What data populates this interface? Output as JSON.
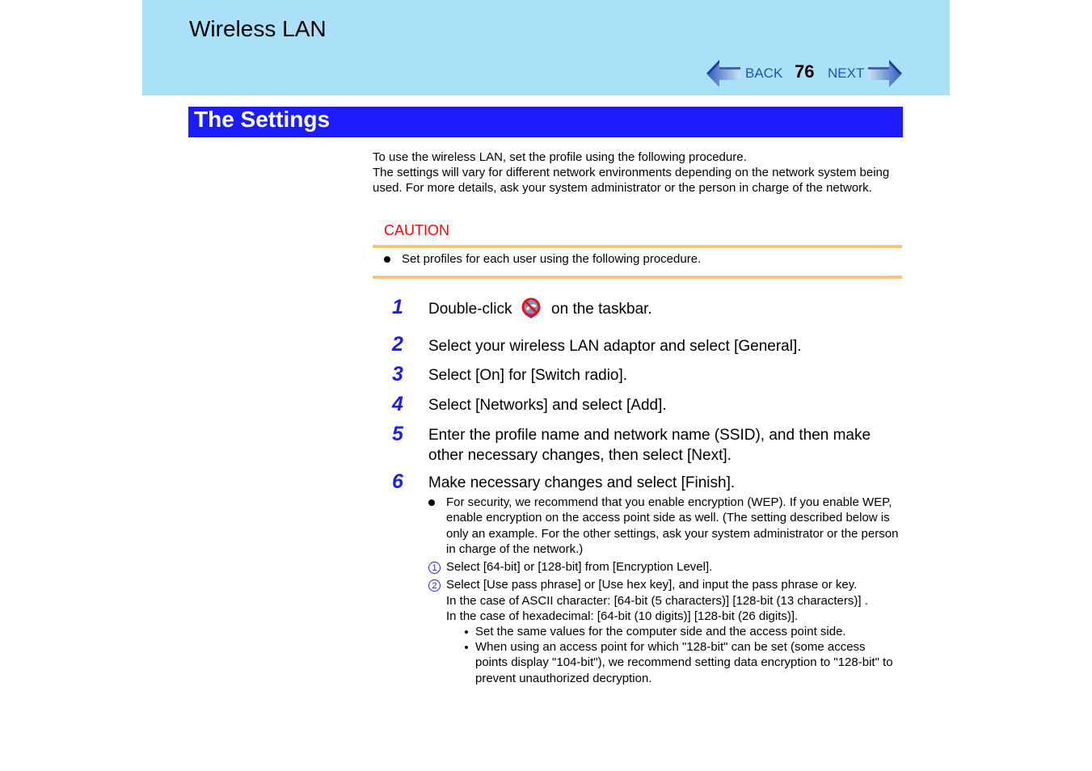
{
  "header": {
    "title": "Wireless LAN",
    "nav": {
      "back_label": "BACK",
      "next_label": "NEXT",
      "page_number": "76",
      "back_icon": "left-arrow-icon",
      "next_icon": "right-arrow-icon"
    }
  },
  "section": {
    "title": "The Settings"
  },
  "intro": {
    "line1": "To use the wireless LAN, set the profile using the following procedure.",
    "line2": "The settings will vary for different network environments depending on the network system being used. For more details, ask your system administrator or the person in charge of the network."
  },
  "caution": {
    "title": "CAUTION",
    "items": [
      "Set profiles for each user using the following procedure."
    ]
  },
  "steps": [
    {
      "num": "1",
      "text_before": "Double-click",
      "icon": "wireless-tray-icon",
      "text_after": "on the taskbar."
    },
    {
      "num": "2",
      "text": "Select your wireless LAN adaptor and select [General]."
    },
    {
      "num": "3",
      "text": "Select [On] for [Switch radio]."
    },
    {
      "num": "4",
      "text": "Select [Networks] and select [Add]."
    },
    {
      "num": "5",
      "text": "Enter the profile name and network name (SSID), and then make other necessary changes, then select [Next]."
    },
    {
      "num": "6",
      "text": "Make necessary changes and select [Finish]."
    }
  ],
  "step6_details": {
    "bullet": "For security, we recommend that you enable encryption (WEP). If you enable WEP, enable encryption on the access point side as well. (The setting described below is only an example. For the other settings, ask your system administrator or the person in charge of the network.)",
    "substeps": [
      {
        "marker": "1",
        "lines": [
          "Select [64-bit] or [128-bit] from [Encryption Level]."
        ]
      },
      {
        "marker": "2",
        "lines": [
          "Select [Use pass phrase] or [Use hex key], and input the pass phrase or key.",
          "In the case of ASCII character: [64-bit (5 characters)] [128-bit (13 characters)] .",
          "In the case of hexadecimal: [64-bit (10 digits)] [128-bit (26 digits)]."
        ]
      }
    ],
    "notes": [
      "Set the same values for the computer side and the access point side.",
      "When using an access point for which \"128-bit\" can be set (some access points display \"104-bit\"), we recommend setting data encryption to \"128-bit\" to prevent unauthorized decryption."
    ]
  },
  "colors": {
    "header_bg": "#aae1f8",
    "section_bar": "#1c1cff",
    "caution_red": "#ff0000",
    "caution_rule": "#f9c47a",
    "step_number": "#1f1fe0",
    "nav_link": "#1f55b0"
  }
}
